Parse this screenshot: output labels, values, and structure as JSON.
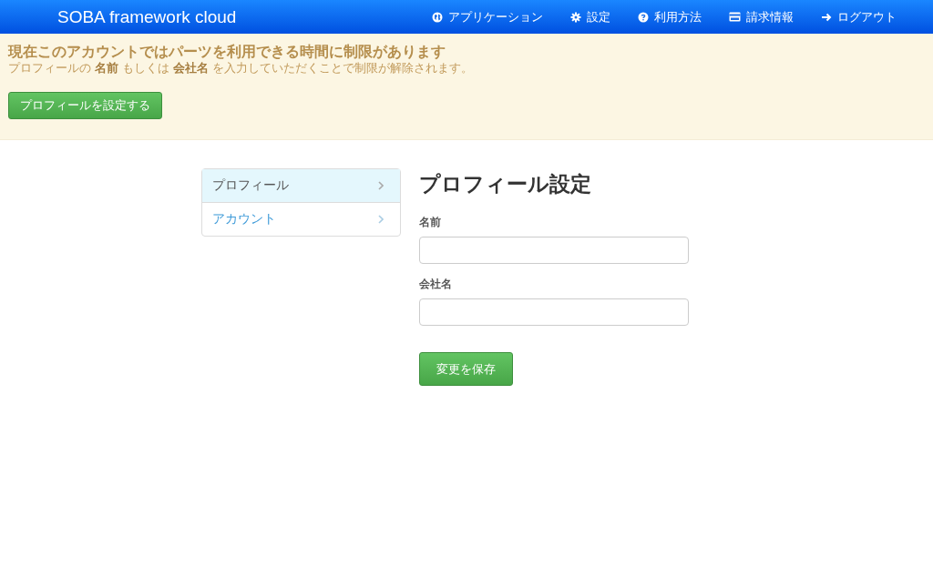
{
  "navbar": {
    "brand": "SOBA framework cloud",
    "items": [
      {
        "kind": "apps",
        "label": "アプリケーション"
      },
      {
        "kind": "settings",
        "label": "設定"
      },
      {
        "kind": "help",
        "label": "利用方法"
      },
      {
        "kind": "billing",
        "label": "請求情報"
      },
      {
        "kind": "logout",
        "label": "ログアウト"
      }
    ]
  },
  "alert": {
    "title": "現在このアカウントではパーツを利用できる時間に制限があります",
    "message": "プロフィールの **名前** もしくは **会社名** を入力していただくことで制限が解除されます。",
    "button": "プロフィールを設定する"
  },
  "sidebar": {
    "items": [
      {
        "label": "プロフィール",
        "selected": true
      },
      {
        "label": "アカウント",
        "selected": false
      }
    ]
  },
  "form": {
    "title": "プロフィール設定",
    "fields": [
      {
        "label": "名前"
      },
      {
        "label": "会社名"
      }
    ],
    "submit": "変更を保存"
  }
}
